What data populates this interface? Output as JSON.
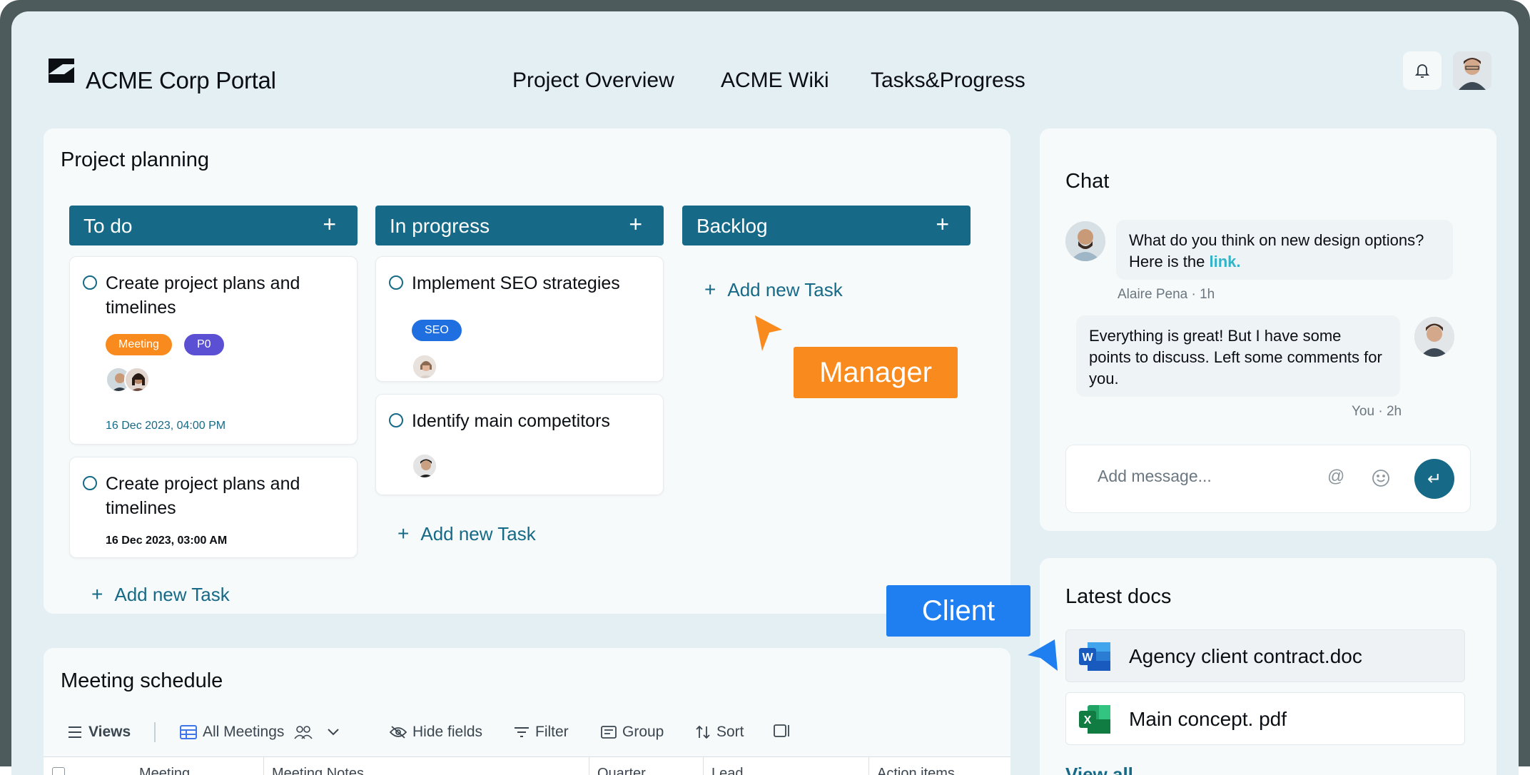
{
  "app": {
    "title": "ACME Corp Portal"
  },
  "nav": [
    "Project Overview",
    "ACME Wiki",
    "Tasks&Progress"
  ],
  "header_icons": {
    "bell": "bell-icon",
    "avatar": "user-avatar"
  },
  "planning": {
    "title": "Project planning",
    "columns": [
      {
        "title": "To do",
        "add_icon": "+"
      },
      {
        "title": "In progress",
        "add_icon": "+"
      },
      {
        "title": "Backlog",
        "add_icon": "+"
      }
    ],
    "todo": [
      {
        "title": "Create project plans and timelines",
        "tags": [
          "Meeting",
          "P0"
        ],
        "date": "16 Dec 2023, 04:00 PM"
      },
      {
        "title": "Create project plans and timelines",
        "date": "16 Dec 2023, 03:00 AM"
      }
    ],
    "in_progress": [
      {
        "title": "Implement SEO strategies",
        "tags": [
          "SEO"
        ]
      },
      {
        "title": "Identify main competitors"
      }
    ],
    "add_task_label": "Add new Task",
    "add_icon": "+",
    "colors": {
      "accent": "#166a87",
      "meeting": "#f98a1e",
      "p0": "#5b4fd4",
      "seo": "#1f6fe0"
    }
  },
  "pointers": {
    "manager": "Manager",
    "client": "Client"
  },
  "chat": {
    "title": "Chat",
    "messages": [
      {
        "text_before": "What do you think on new design options? Here is the ",
        "link": "link.",
        "meta": "Alaire Pena · 1h"
      },
      {
        "text": "Everything is great! But I have some points to discuss. Left some comments for you.",
        "meta": "You · 2h"
      }
    ],
    "input_placeholder": "Add message...",
    "at_icon": "@",
    "send_icon": "↵"
  },
  "docs": {
    "title": "Latest docs",
    "items": [
      {
        "name": "Agency client contract.doc",
        "icon": "word-icon"
      },
      {
        "name": "Main concept. pdf",
        "icon": "excel-icon"
      }
    ],
    "view_all": "View all"
  },
  "meetings": {
    "title": "Meeting schedule",
    "toolbar": [
      "Views",
      "All Meetings",
      "Hide fields",
      "Filter",
      "Group",
      "Sort"
    ],
    "columns": [
      "Meeting",
      "Meeting Notes",
      "Quarter",
      "Lead",
      "Action items"
    ]
  }
}
